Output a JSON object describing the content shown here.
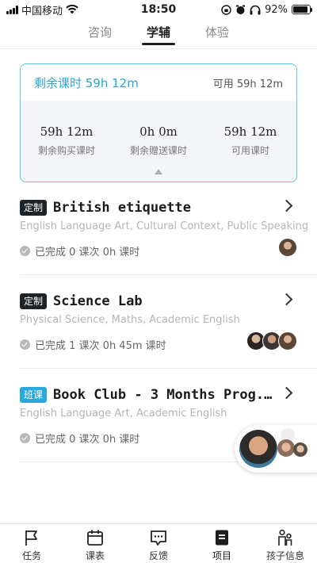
{
  "status_bar": {
    "carrier": "中国移动",
    "time": "18:50",
    "battery": "92%"
  },
  "tabs": [
    {
      "label": "咨询",
      "active": false
    },
    {
      "label": "学辅",
      "active": true
    },
    {
      "label": "体验",
      "active": false
    }
  ],
  "hours_card": {
    "remaining": "剩余课时 59h 12m",
    "available": "可用 59h 12m",
    "stats": [
      {
        "value": "59h 12m",
        "label": "剩余购买课时"
      },
      {
        "value": "0h 0m",
        "label": "剩余赠送课时"
      },
      {
        "value": "59h 12m",
        "label": "可用课时"
      }
    ]
  },
  "courses": [
    {
      "badge": "定制",
      "badge_color": "#1e2328",
      "title": "British etiquette",
      "subjects": "English Language Art, Cultural Context, Public Speaking",
      "progress": "已完成 0 课次  0h 课时",
      "avatars": 1
    },
    {
      "badge": "定制",
      "badge_color": "#1e2328",
      "title": "Science Lab",
      "subjects": "Physical Science, Maths, Academic English",
      "progress": "已完成 1 课次  0h 45m 课时",
      "avatars": 3
    },
    {
      "badge": "班课",
      "badge_color": "#29a8e0",
      "title": "Book Club - 3 Months Prog...",
      "subjects": "English Language Art, Academic English",
      "progress": "已完成 0 课次  0h 课时",
      "avatars": 0
    }
  ],
  "bottom_nav": [
    {
      "label": "任务",
      "icon": "flag-icon"
    },
    {
      "label": "课表",
      "icon": "calendar-icon"
    },
    {
      "label": "反馈",
      "icon": "chat-icon"
    },
    {
      "label": "项目",
      "icon": "document-icon",
      "active": true
    },
    {
      "label": "孩子信息",
      "icon": "family-icon"
    }
  ],
  "colors": {
    "accent": "#2aa5d6",
    "badge_dark": "#1e2328",
    "badge_blue": "#29a8e0"
  }
}
